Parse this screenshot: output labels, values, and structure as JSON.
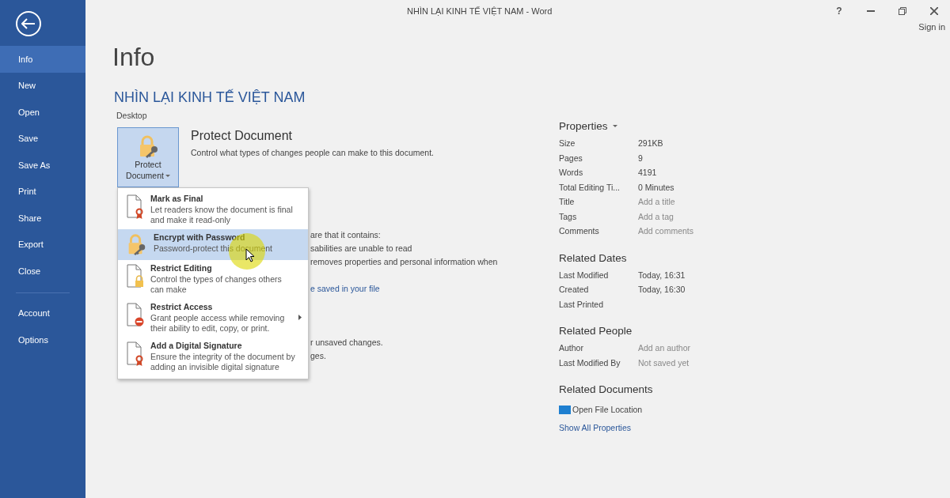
{
  "window": {
    "title": "NHÌN LẠI KINH TẾ VIỆT NAM - Word",
    "help": "?",
    "sign_in": "Sign in"
  },
  "sidebar": {
    "items": [
      {
        "label": "Info",
        "selected": true
      },
      {
        "label": "New",
        "selected": false
      },
      {
        "label": "Open",
        "selected": false
      },
      {
        "label": "Save",
        "selected": false
      },
      {
        "label": "Save As",
        "selected": false
      },
      {
        "label": "Print",
        "selected": false
      },
      {
        "label": "Share",
        "selected": false
      },
      {
        "label": "Export",
        "selected": false
      },
      {
        "label": "Close",
        "selected": false
      }
    ],
    "bottom_items": [
      {
        "label": "Account",
        "selected": false
      },
      {
        "label": "Options",
        "selected": false
      }
    ]
  },
  "page": {
    "heading": "Info",
    "document_title": "NHÌN LẠI KINH TẾ VIỆT NAM",
    "location": "Desktop"
  },
  "protect": {
    "button_lines": [
      "Protect",
      "Document"
    ],
    "title": "Protect Document",
    "description": "Control what types of changes people can make to this document."
  },
  "partly_hidden": [
    {
      "kind": "text",
      "text": "are that it contains:"
    },
    {
      "kind": "text",
      "text": "sabilities are unable to read"
    },
    {
      "kind": "text",
      "text": "removes properties and personal information when"
    },
    {
      "kind": "gap"
    },
    {
      "kind": "link",
      "text": "e saved in your file"
    },
    {
      "kind": "gap"
    },
    {
      "kind": "gap"
    },
    {
      "kind": "gap"
    },
    {
      "kind": "text",
      "text": "r unsaved changes."
    },
    {
      "kind": "text",
      "text": "ges."
    }
  ],
  "menu": {
    "items": [
      {
        "title": "Mark as Final",
        "description": "Let readers know the document is final and make it read-only",
        "selected": false,
        "submenu": false
      },
      {
        "title": "Encrypt with Password",
        "description": "Password-protect this document",
        "selected": true,
        "submenu": false
      },
      {
        "title": "Restrict Editing",
        "description": "Control the types of changes others can make",
        "selected": false,
        "submenu": false
      },
      {
        "title": "Restrict Access",
        "description": "Grant people access while removing their ability to edit, copy, or print.",
        "selected": false,
        "submenu": true
      },
      {
        "title": "Add a Digital Signature",
        "description": "Ensure the integrity of the document by adding an invisible digital signature",
        "selected": false,
        "submenu": false
      }
    ]
  },
  "properties": {
    "heading": "Properties",
    "rows": [
      {
        "label": "Size",
        "value": "291KB"
      },
      {
        "label": "Pages",
        "value": "9"
      },
      {
        "label": "Words",
        "value": "4191"
      },
      {
        "label": "Total Editing Ti...",
        "value": "0 Minutes"
      },
      {
        "label": "Title",
        "placeholder": "Add a title"
      },
      {
        "label": "Tags",
        "placeholder": "Add a tag"
      },
      {
        "label": "Comments",
        "placeholder": "Add comments"
      }
    ]
  },
  "related_dates": {
    "heading": "Related Dates",
    "rows": [
      {
        "label": "Last Modified",
        "value": "Today, 16:31"
      },
      {
        "label": "Created",
        "value": "Today, 16:30"
      },
      {
        "label": "Last Printed"
      }
    ]
  },
  "related_people": {
    "heading": "Related People",
    "rows": [
      {
        "label": "Author",
        "placeholder": "Add an author"
      },
      {
        "label": "Last Modified By",
        "placeholder": "Not saved yet"
      }
    ]
  },
  "related_documents": {
    "heading": "Related Documents",
    "open_location": "Open File Location",
    "show_all": "Show All Properties"
  }
}
